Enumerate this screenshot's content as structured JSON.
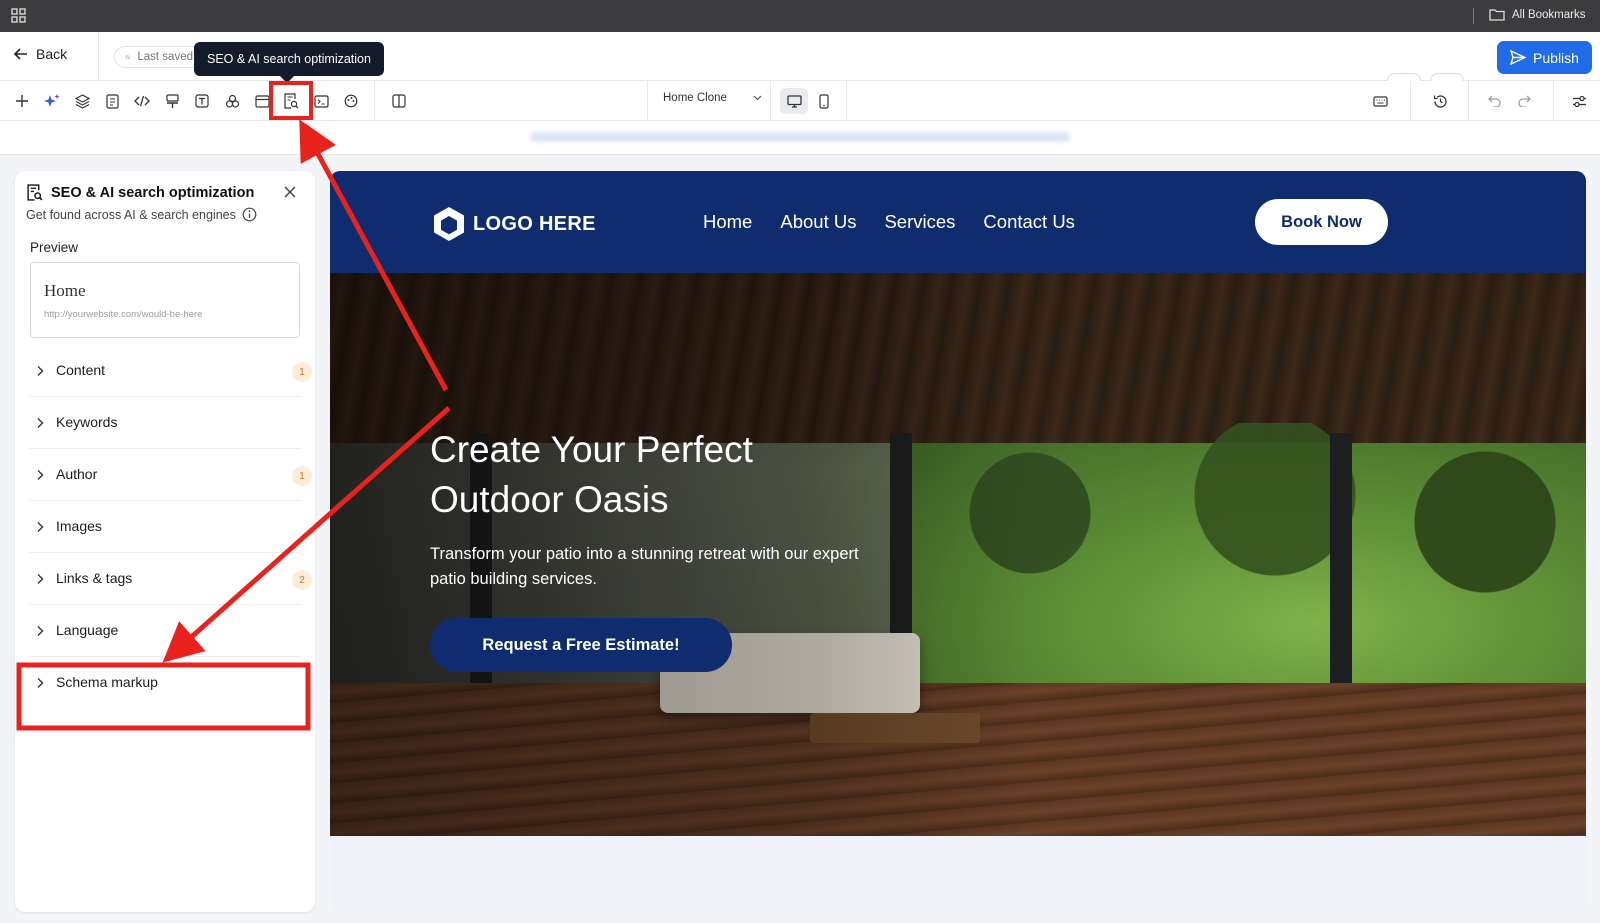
{
  "browser": {
    "bookmarks_label": "All Bookmarks"
  },
  "header": {
    "back_label": "Back",
    "saved_status": "Last saved",
    "tooltip": "SEO & AI search optimization",
    "publish_label": "Publish"
  },
  "toolbar": {
    "tools": [
      "add-icon",
      "ai-sparkle-icon",
      "layers-icon",
      "pages-icon",
      "code-icon",
      "brush-icon",
      "text-icon",
      "apps-icon",
      "layout-icon",
      "seo-icon",
      "terminal-icon",
      "palette-icon",
      "split-view-icon"
    ],
    "page_select": "Home Clone"
  },
  "seo_panel": {
    "title": "SEO & AI search optimization",
    "subtitle": "Get found across AI & search engines",
    "preview_label": "Preview",
    "preview_title": "Home",
    "preview_url": "http://yourwebsite.com/would-be-here",
    "sections": [
      {
        "label": "Content",
        "badge": "1"
      },
      {
        "label": "Keywords",
        "badge": ""
      },
      {
        "label": "Author",
        "badge": "1"
      },
      {
        "label": "Images",
        "badge": ""
      },
      {
        "label": "Links & tags",
        "badge": "2"
      },
      {
        "label": "Language",
        "badge": ""
      },
      {
        "label": "Schema markup",
        "badge": ""
      }
    ]
  },
  "site": {
    "logo": "LOGO HERE",
    "nav": [
      "Home",
      "About Us",
      "Services",
      "Contact Us"
    ],
    "book_label": "Book Now",
    "hero_title": "Create Your Perfect Outdoor Oasis",
    "hero_text": "Transform your patio into a stunning retreat with our expert patio building services.",
    "hero_cta": "Request a Free Estimate!"
  },
  "colors": {
    "accent": "#1f6be8",
    "site_navy": "#0f2d6e",
    "annotation_red": "#e8231e",
    "badge_bg": "#fdecd8"
  }
}
